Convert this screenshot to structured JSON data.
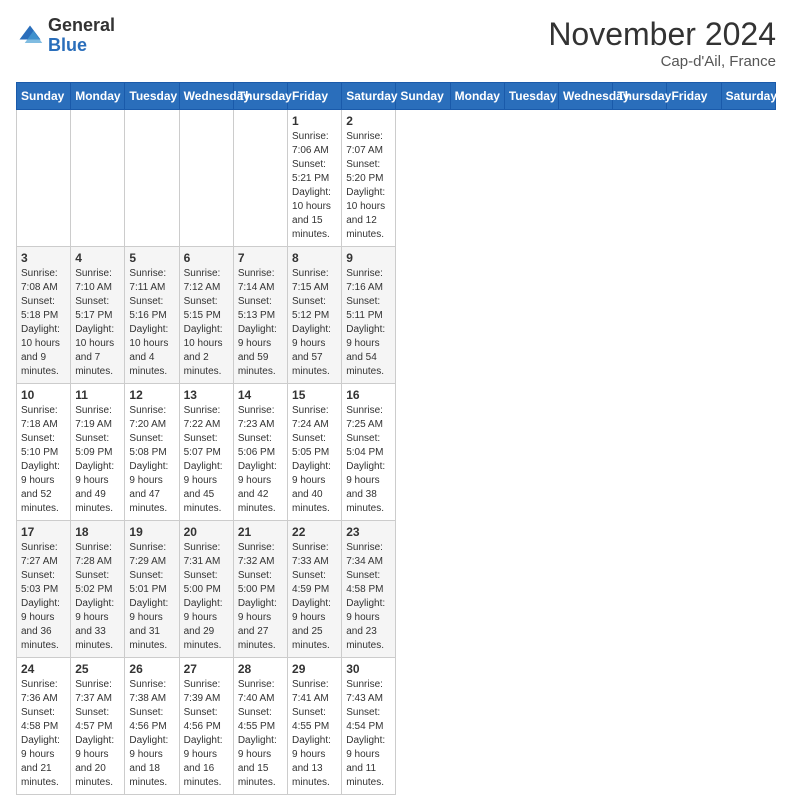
{
  "header": {
    "logo_general": "General",
    "logo_blue": "Blue",
    "month_title": "November 2024",
    "location": "Cap-d'Ail, France"
  },
  "days_of_week": [
    "Sunday",
    "Monday",
    "Tuesday",
    "Wednesday",
    "Thursday",
    "Friday",
    "Saturday"
  ],
  "weeks": [
    [
      {
        "day": "",
        "info": ""
      },
      {
        "day": "",
        "info": ""
      },
      {
        "day": "",
        "info": ""
      },
      {
        "day": "",
        "info": ""
      },
      {
        "day": "",
        "info": ""
      },
      {
        "day": "1",
        "info": "Sunrise: 7:06 AM\nSunset: 5:21 PM\nDaylight: 10 hours and 15 minutes."
      },
      {
        "day": "2",
        "info": "Sunrise: 7:07 AM\nSunset: 5:20 PM\nDaylight: 10 hours and 12 minutes."
      }
    ],
    [
      {
        "day": "3",
        "info": "Sunrise: 7:08 AM\nSunset: 5:18 PM\nDaylight: 10 hours and 9 minutes."
      },
      {
        "day": "4",
        "info": "Sunrise: 7:10 AM\nSunset: 5:17 PM\nDaylight: 10 hours and 7 minutes."
      },
      {
        "day": "5",
        "info": "Sunrise: 7:11 AM\nSunset: 5:16 PM\nDaylight: 10 hours and 4 minutes."
      },
      {
        "day": "6",
        "info": "Sunrise: 7:12 AM\nSunset: 5:15 PM\nDaylight: 10 hours and 2 minutes."
      },
      {
        "day": "7",
        "info": "Sunrise: 7:14 AM\nSunset: 5:13 PM\nDaylight: 9 hours and 59 minutes."
      },
      {
        "day": "8",
        "info": "Sunrise: 7:15 AM\nSunset: 5:12 PM\nDaylight: 9 hours and 57 minutes."
      },
      {
        "day": "9",
        "info": "Sunrise: 7:16 AM\nSunset: 5:11 PM\nDaylight: 9 hours and 54 minutes."
      }
    ],
    [
      {
        "day": "10",
        "info": "Sunrise: 7:18 AM\nSunset: 5:10 PM\nDaylight: 9 hours and 52 minutes."
      },
      {
        "day": "11",
        "info": "Sunrise: 7:19 AM\nSunset: 5:09 PM\nDaylight: 9 hours and 49 minutes."
      },
      {
        "day": "12",
        "info": "Sunrise: 7:20 AM\nSunset: 5:08 PM\nDaylight: 9 hours and 47 minutes."
      },
      {
        "day": "13",
        "info": "Sunrise: 7:22 AM\nSunset: 5:07 PM\nDaylight: 9 hours and 45 minutes."
      },
      {
        "day": "14",
        "info": "Sunrise: 7:23 AM\nSunset: 5:06 PM\nDaylight: 9 hours and 42 minutes."
      },
      {
        "day": "15",
        "info": "Sunrise: 7:24 AM\nSunset: 5:05 PM\nDaylight: 9 hours and 40 minutes."
      },
      {
        "day": "16",
        "info": "Sunrise: 7:25 AM\nSunset: 5:04 PM\nDaylight: 9 hours and 38 minutes."
      }
    ],
    [
      {
        "day": "17",
        "info": "Sunrise: 7:27 AM\nSunset: 5:03 PM\nDaylight: 9 hours and 36 minutes."
      },
      {
        "day": "18",
        "info": "Sunrise: 7:28 AM\nSunset: 5:02 PM\nDaylight: 9 hours and 33 minutes."
      },
      {
        "day": "19",
        "info": "Sunrise: 7:29 AM\nSunset: 5:01 PM\nDaylight: 9 hours and 31 minutes."
      },
      {
        "day": "20",
        "info": "Sunrise: 7:31 AM\nSunset: 5:00 PM\nDaylight: 9 hours and 29 minutes."
      },
      {
        "day": "21",
        "info": "Sunrise: 7:32 AM\nSunset: 5:00 PM\nDaylight: 9 hours and 27 minutes."
      },
      {
        "day": "22",
        "info": "Sunrise: 7:33 AM\nSunset: 4:59 PM\nDaylight: 9 hours and 25 minutes."
      },
      {
        "day": "23",
        "info": "Sunrise: 7:34 AM\nSunset: 4:58 PM\nDaylight: 9 hours and 23 minutes."
      }
    ],
    [
      {
        "day": "24",
        "info": "Sunrise: 7:36 AM\nSunset: 4:58 PM\nDaylight: 9 hours and 21 minutes."
      },
      {
        "day": "25",
        "info": "Sunrise: 7:37 AM\nSunset: 4:57 PM\nDaylight: 9 hours and 20 minutes."
      },
      {
        "day": "26",
        "info": "Sunrise: 7:38 AM\nSunset: 4:56 PM\nDaylight: 9 hours and 18 minutes."
      },
      {
        "day": "27",
        "info": "Sunrise: 7:39 AM\nSunset: 4:56 PM\nDaylight: 9 hours and 16 minutes."
      },
      {
        "day": "28",
        "info": "Sunrise: 7:40 AM\nSunset: 4:55 PM\nDaylight: 9 hours and 15 minutes."
      },
      {
        "day": "29",
        "info": "Sunrise: 7:41 AM\nSunset: 4:55 PM\nDaylight: 9 hours and 13 minutes."
      },
      {
        "day": "30",
        "info": "Sunrise: 7:43 AM\nSunset: 4:54 PM\nDaylight: 9 hours and 11 minutes."
      }
    ]
  ]
}
